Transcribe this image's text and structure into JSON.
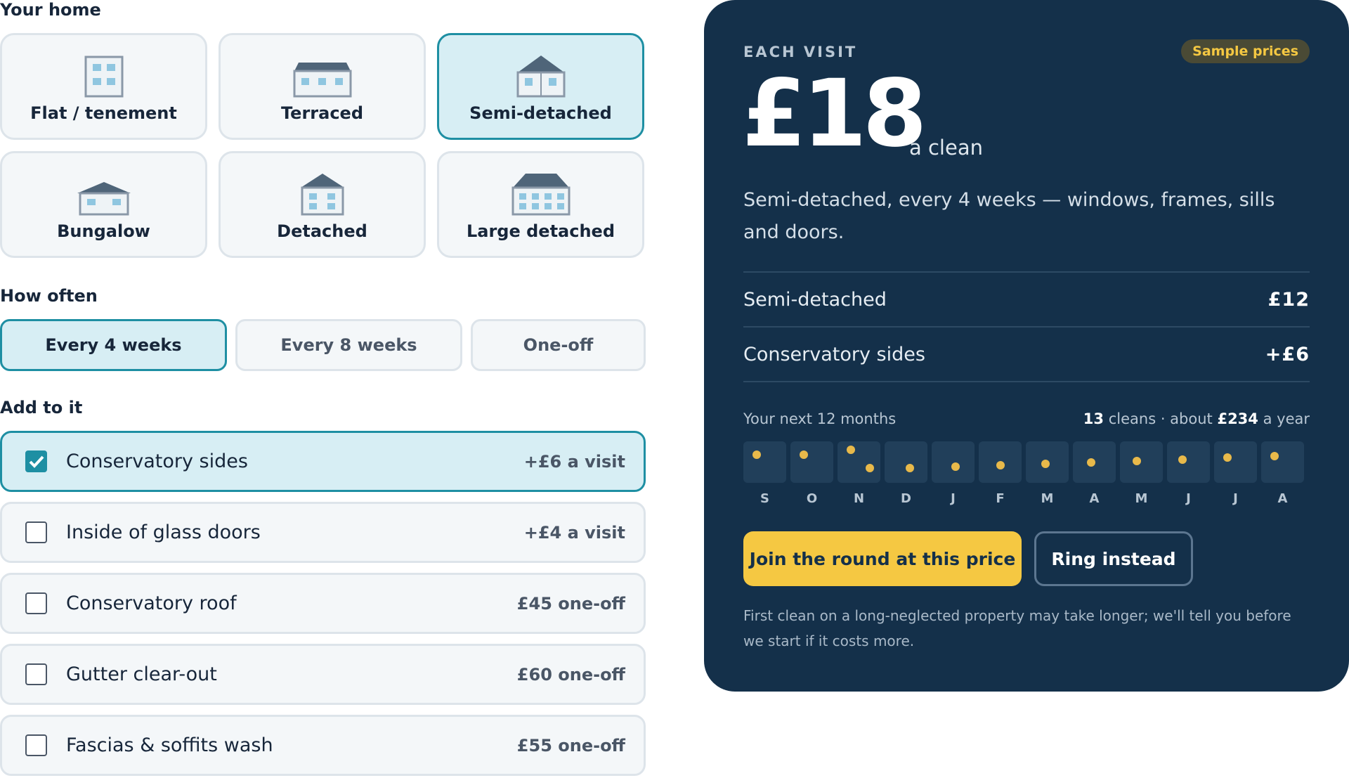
{
  "home": {
    "heading": "Your home",
    "options": [
      {
        "label": "Flat / tenement",
        "icon": "flat-icon",
        "selected": false
      },
      {
        "label": "Terraced",
        "icon": "terraced-house-icon",
        "selected": false
      },
      {
        "label": "Semi-detached",
        "icon": "semi-detached-house-icon",
        "selected": true
      },
      {
        "label": "Bungalow",
        "icon": "bungalow-icon",
        "selected": false
      },
      {
        "label": "Detached",
        "icon": "detached-house-icon",
        "selected": false
      },
      {
        "label": "Large detached",
        "icon": "large-detached-house-icon",
        "selected": false
      }
    ]
  },
  "frequency": {
    "heading": "How often",
    "options": [
      {
        "label": "Every 4 weeks",
        "selected": true
      },
      {
        "label": "Every 8 weeks",
        "selected": false
      },
      {
        "label": "One-off",
        "selected": false
      }
    ]
  },
  "addons": {
    "heading": "Add to it",
    "items": [
      {
        "label": "Conservatory sides",
        "price": "+£6 a visit",
        "checked": true
      },
      {
        "label": "Inside of glass doors",
        "price": "+£4 a visit",
        "checked": false
      },
      {
        "label": "Conservatory roof",
        "price": "£45 one-off",
        "checked": false
      },
      {
        "label": "Gutter clear-out",
        "price": "£60 one-off",
        "checked": false
      },
      {
        "label": "Fascias & soffits wash",
        "price": "£55 one-off",
        "checked": false
      }
    ]
  },
  "quote": {
    "eyebrow": "EACH VISIT",
    "badge": "Sample prices",
    "price": "£18",
    "unit": "a clean",
    "summary": "Semi-detached, every 4 weeks — windows, frames, sills and doors.",
    "lines": [
      {
        "label": "Semi-detached",
        "amount": "£12"
      },
      {
        "label": "Conservatory sides",
        "amount": "+£6"
      }
    ],
    "schedule": {
      "title": "Your next 12 months",
      "clean_count": "13",
      "cleans_word": "cleans · about",
      "yearly": "£234",
      "per_year": "a year",
      "months": [
        "S",
        "O",
        "N",
        "D",
        "J",
        "F",
        "M",
        "A",
        "M",
        "J",
        "J",
        "A"
      ]
    },
    "primary_cta": "Join the round at this price",
    "secondary_cta": "Ring instead",
    "footnote": "First clean on a long-neglected property may take longer; we'll tell you before we start if it costs more."
  },
  "colors": {
    "accent": "#1e8fa3",
    "panel": "#14304a",
    "cta": "#f5c842",
    "dot": "#e8b94a"
  }
}
